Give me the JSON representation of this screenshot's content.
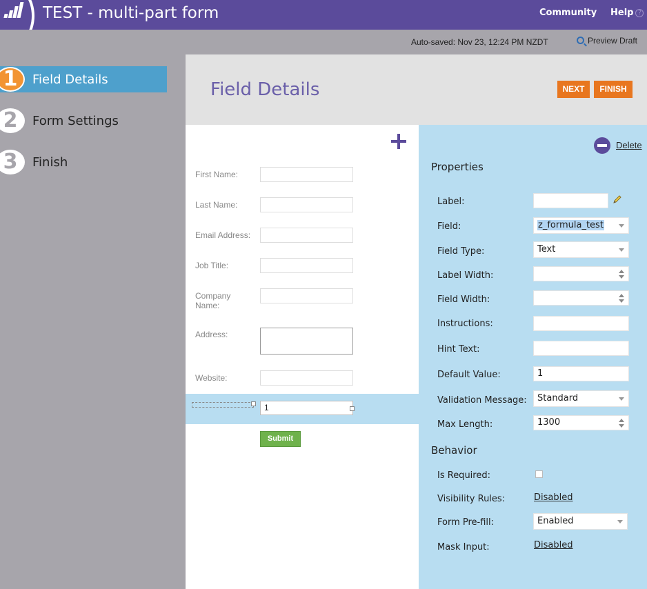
{
  "header": {
    "title": "TEST - multi-part form",
    "community": "Community",
    "help": "Help",
    "help_icon": "?"
  },
  "steps": [
    {
      "num": "1",
      "label": "Field Details",
      "active": true
    },
    {
      "num": "2",
      "label": "Form Settings",
      "active": false
    },
    {
      "num": "3",
      "label": "Finish",
      "active": false
    }
  ],
  "autosave": {
    "text": "Auto-saved: Nov 23, 12:24 PM NZDT",
    "preview": "Preview Draft"
  },
  "page": {
    "title": "Field Details",
    "next": "NEXT",
    "finish": "FINISH"
  },
  "form": {
    "fields": [
      {
        "label": "First Name:",
        "value": ""
      },
      {
        "label": "Last Name:",
        "value": ""
      },
      {
        "label": "Email Address:",
        "value": ""
      },
      {
        "label": "Job Title:",
        "value": ""
      },
      {
        "label": "Company Name:",
        "value": ""
      },
      {
        "label": "Address:",
        "value": ""
      },
      {
        "label": "Website:",
        "value": ""
      }
    ],
    "selected_value": "1",
    "submit": "Submit"
  },
  "properties": {
    "delete": "Delete",
    "properties_title": "Properties",
    "label": {
      "label": "Label:",
      "value": ""
    },
    "field": {
      "label": "Field:",
      "value": "z_formula_test"
    },
    "field_type": {
      "label": "Field Type:",
      "value": "Text"
    },
    "label_width": {
      "label": "Label Width:",
      "value": ""
    },
    "field_width": {
      "label": "Field Width:",
      "value": ""
    },
    "instructions": {
      "label": "Instructions:",
      "value": ""
    },
    "hint_text": {
      "label": "Hint Text:",
      "value": ""
    },
    "default_value": {
      "label": "Default Value:",
      "value": "1"
    },
    "validation_message": {
      "label": "Validation Message:",
      "value": "Standard"
    },
    "max_length": {
      "label": "Max Length:",
      "value": "1300"
    },
    "behavior_title": "Behavior",
    "is_required": {
      "label": "Is Required:",
      "checked": false
    },
    "visibility_rules": {
      "label": "Visibility Rules:",
      "value": "Disabled"
    },
    "form_prefill": {
      "label": "Form Pre-fill:",
      "value": "Enabled"
    },
    "mask_input": {
      "label": "Mask Input:",
      "value": "Disabled"
    }
  },
  "colors": {
    "brand_purple": "#5b4b9b",
    "active_step_blue": "#4ea0cc",
    "step_orange": "#f29432",
    "button_orange": "#e8761f",
    "panel_blue": "#b8ddf1",
    "submit_green": "#6fb24c"
  },
  "icons": {
    "logo": "marketo-logo-icon",
    "help": "question-circle-icon",
    "preview": "magnifier-icon",
    "add": "plus-icon",
    "delete": "minus-circle-icon",
    "edit": "pencil-icon"
  }
}
